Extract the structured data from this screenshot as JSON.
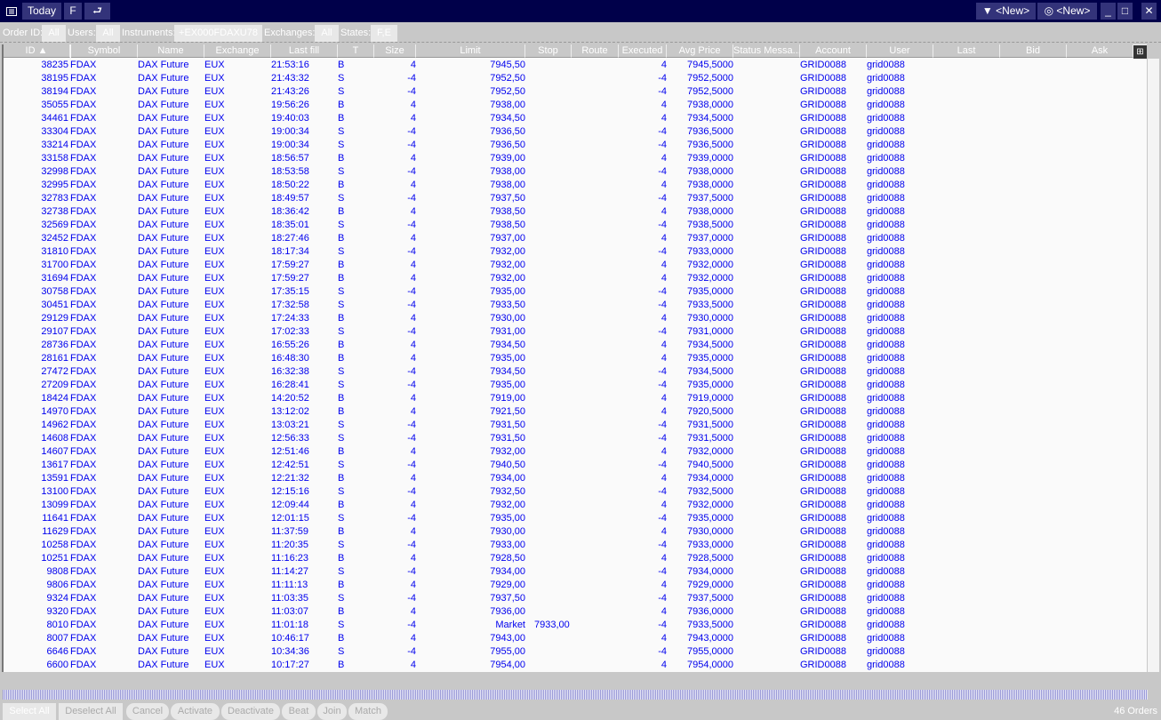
{
  "toolbar": {
    "today": "Today",
    "f": "F",
    "filter_new": "<New>",
    "view_new": "<New>"
  },
  "filters": {
    "order_id_label": "Order ID:",
    "order_id": "All",
    "users_label": "Users:",
    "users": "All",
    "instruments_label": "Instruments:",
    "instruments": "+EX000FDAXU78",
    "exchanges_label": "Exchanges:",
    "exchanges": "All",
    "states_label": "States:",
    "states": "F,E"
  },
  "columns": [
    "ID ▲",
    "Symbol",
    "Name",
    "Exchange",
    "Last fill",
    "T",
    "Size",
    "Limit",
    "Stop",
    "Route",
    "Executed",
    "Avg Price",
    "Status Messa...",
    "Account",
    "User",
    "Last",
    "Bid",
    "Ask"
  ],
  "table": {
    "rows": [
      [
        "38235",
        "FDAX",
        "DAX Future",
        "EUX",
        "21:53:16",
        "B",
        "4",
        "7945,50",
        "",
        "",
        "4",
        "7945,5000",
        "",
        "GRID0088",
        "grid0088"
      ],
      [
        "38195",
        "FDAX",
        "DAX Future",
        "EUX",
        "21:43:32",
        "S",
        "-4",
        "7952,50",
        "",
        "",
        "-4",
        "7952,5000",
        "",
        "GRID0088",
        "grid0088"
      ],
      [
        "38194",
        "FDAX",
        "DAX Future",
        "EUX",
        "21:43:26",
        "S",
        "-4",
        "7952,50",
        "",
        "",
        "-4",
        "7952,5000",
        "",
        "GRID0088",
        "grid0088"
      ],
      [
        "35055",
        "FDAX",
        "DAX Future",
        "EUX",
        "19:56:26",
        "B",
        "4",
        "7938,00",
        "",
        "",
        "4",
        "7938,0000",
        "",
        "GRID0088",
        "grid0088"
      ],
      [
        "34461",
        "FDAX",
        "DAX Future",
        "EUX",
        "19:40:03",
        "B",
        "4",
        "7934,50",
        "",
        "",
        "4",
        "7934,5000",
        "",
        "GRID0088",
        "grid0088"
      ],
      [
        "33304",
        "FDAX",
        "DAX Future",
        "EUX",
        "19:00:34",
        "S",
        "-4",
        "7936,50",
        "",
        "",
        "-4",
        "7936,5000",
        "",
        "GRID0088",
        "grid0088"
      ],
      [
        "33214",
        "FDAX",
        "DAX Future",
        "EUX",
        "19:00:34",
        "S",
        "-4",
        "7936,50",
        "",
        "",
        "-4",
        "7936,5000",
        "",
        "GRID0088",
        "grid0088"
      ],
      [
        "33158",
        "FDAX",
        "DAX Future",
        "EUX",
        "18:56:57",
        "B",
        "4",
        "7939,00",
        "",
        "",
        "4",
        "7939,0000",
        "",
        "GRID0088",
        "grid0088"
      ],
      [
        "32998",
        "FDAX",
        "DAX Future",
        "EUX",
        "18:53:58",
        "S",
        "-4",
        "7938,00",
        "",
        "",
        "-4",
        "7938,0000",
        "",
        "GRID0088",
        "grid0088"
      ],
      [
        "32995",
        "FDAX",
        "DAX Future",
        "EUX",
        "18:50:22",
        "B",
        "4",
        "7938,00",
        "",
        "",
        "4",
        "7938,0000",
        "",
        "GRID0088",
        "grid0088"
      ],
      [
        "32783",
        "FDAX",
        "DAX Future",
        "EUX",
        "18:49:57",
        "S",
        "-4",
        "7937,50",
        "",
        "",
        "-4",
        "7937,5000",
        "",
        "GRID0088",
        "grid0088"
      ],
      [
        "32738",
        "FDAX",
        "DAX Future",
        "EUX",
        "18:36:42",
        "B",
        "4",
        "7938,50",
        "",
        "",
        "4",
        "7938,0000",
        "",
        "GRID0088",
        "grid0088"
      ],
      [
        "32569",
        "FDAX",
        "DAX Future",
        "EUX",
        "18:35:01",
        "S",
        "-4",
        "7938,50",
        "",
        "",
        "-4",
        "7938,5000",
        "",
        "GRID0088",
        "grid0088"
      ],
      [
        "32452",
        "FDAX",
        "DAX Future",
        "EUX",
        "18:27:46",
        "B",
        "4",
        "7937,00",
        "",
        "",
        "4",
        "7937,0000",
        "",
        "GRID0088",
        "grid0088"
      ],
      [
        "31810",
        "FDAX",
        "DAX Future",
        "EUX",
        "18:17:34",
        "S",
        "-4",
        "7932,00",
        "",
        "",
        "-4",
        "7933,0000",
        "",
        "GRID0088",
        "grid0088"
      ],
      [
        "31700",
        "FDAX",
        "DAX Future",
        "EUX",
        "17:59:27",
        "B",
        "4",
        "7932,00",
        "",
        "",
        "4",
        "7932,0000",
        "",
        "GRID0088",
        "grid0088"
      ],
      [
        "31694",
        "FDAX",
        "DAX Future",
        "EUX",
        "17:59:27",
        "B",
        "4",
        "7932,00",
        "",
        "",
        "4",
        "7932,0000",
        "",
        "GRID0088",
        "grid0088"
      ],
      [
        "30758",
        "FDAX",
        "DAX Future",
        "EUX",
        "17:35:15",
        "S",
        "-4",
        "7935,00",
        "",
        "",
        "-4",
        "7935,0000",
        "",
        "GRID0088",
        "grid0088"
      ],
      [
        "30451",
        "FDAX",
        "DAX Future",
        "EUX",
        "17:32:58",
        "S",
        "-4",
        "7933,50",
        "",
        "",
        "-4",
        "7933,5000",
        "",
        "GRID0088",
        "grid0088"
      ],
      [
        "29129",
        "FDAX",
        "DAX Future",
        "EUX",
        "17:24:33",
        "B",
        "4",
        "7930,00",
        "",
        "",
        "4",
        "7930,0000",
        "",
        "GRID0088",
        "grid0088"
      ],
      [
        "29107",
        "FDAX",
        "DAX Future",
        "EUX",
        "17:02:33",
        "S",
        "-4",
        "7931,00",
        "",
        "",
        "-4",
        "7931,0000",
        "",
        "GRID0088",
        "grid0088"
      ],
      [
        "28736",
        "FDAX",
        "DAX Future",
        "EUX",
        "16:55:26",
        "B",
        "4",
        "7934,50",
        "",
        "",
        "4",
        "7934,5000",
        "",
        "GRID0088",
        "grid0088"
      ],
      [
        "28161",
        "FDAX",
        "DAX Future",
        "EUX",
        "16:48:30",
        "B",
        "4",
        "7935,00",
        "",
        "",
        "4",
        "7935,0000",
        "",
        "GRID0088",
        "grid0088"
      ],
      [
        "27472",
        "FDAX",
        "DAX Future",
        "EUX",
        "16:32:38",
        "S",
        "-4",
        "7934,50",
        "",
        "",
        "-4",
        "7934,5000",
        "",
        "GRID0088",
        "grid0088"
      ],
      [
        "27209",
        "FDAX",
        "DAX Future",
        "EUX",
        "16:28:41",
        "S",
        "-4",
        "7935,00",
        "",
        "",
        "-4",
        "7935,0000",
        "",
        "GRID0088",
        "grid0088"
      ],
      [
        "18424",
        "FDAX",
        "DAX Future",
        "EUX",
        "14:20:52",
        "B",
        "4",
        "7919,00",
        "",
        "",
        "4",
        "7919,0000",
        "",
        "GRID0088",
        "grid0088"
      ],
      [
        "14970",
        "FDAX",
        "DAX Future",
        "EUX",
        "13:12:02",
        "B",
        "4",
        "7921,50",
        "",
        "",
        "4",
        "7920,5000",
        "",
        "GRID0088",
        "grid0088"
      ],
      [
        "14962",
        "FDAX",
        "DAX Future",
        "EUX",
        "13:03:21",
        "S",
        "-4",
        "7931,50",
        "",
        "",
        "-4",
        "7931,5000",
        "",
        "GRID0088",
        "grid0088"
      ],
      [
        "14608",
        "FDAX",
        "DAX Future",
        "EUX",
        "12:56:33",
        "S",
        "-4",
        "7931,50",
        "",
        "",
        "-4",
        "7931,5000",
        "",
        "GRID0088",
        "grid0088"
      ],
      [
        "14607",
        "FDAX",
        "DAX Future",
        "EUX",
        "12:51:46",
        "B",
        "4",
        "7932,00",
        "",
        "",
        "4",
        "7932,0000",
        "",
        "GRID0088",
        "grid0088"
      ],
      [
        "13617",
        "FDAX",
        "DAX Future",
        "EUX",
        "12:42:51",
        "S",
        "-4",
        "7940,50",
        "",
        "",
        "-4",
        "7940,5000",
        "",
        "GRID0088",
        "grid0088"
      ],
      [
        "13591",
        "FDAX",
        "DAX Future",
        "EUX",
        "12:21:32",
        "B",
        "4",
        "7934,00",
        "",
        "",
        "4",
        "7934,0000",
        "",
        "GRID0088",
        "grid0088"
      ],
      [
        "13100",
        "FDAX",
        "DAX Future",
        "EUX",
        "12:15:16",
        "S",
        "-4",
        "7932,50",
        "",
        "",
        "-4",
        "7932,5000",
        "",
        "GRID0088",
        "grid0088"
      ],
      [
        "13099",
        "FDAX",
        "DAX Future",
        "EUX",
        "12:09:44",
        "B",
        "4",
        "7932,00",
        "",
        "",
        "4",
        "7932,0000",
        "",
        "GRID0088",
        "grid0088"
      ],
      [
        "11641",
        "FDAX",
        "DAX Future",
        "EUX",
        "12:01:15",
        "S",
        "-4",
        "7935,00",
        "",
        "",
        "-4",
        "7935,0000",
        "",
        "GRID0088",
        "grid0088"
      ],
      [
        "11629",
        "FDAX",
        "DAX Future",
        "EUX",
        "11:37:59",
        "B",
        "4",
        "7930,00",
        "",
        "",
        "4",
        "7930,0000",
        "",
        "GRID0088",
        "grid0088"
      ],
      [
        "10258",
        "FDAX",
        "DAX Future",
        "EUX",
        "11:20:35",
        "S",
        "-4",
        "7933,00",
        "",
        "",
        "-4",
        "7933,0000",
        "",
        "GRID0088",
        "grid0088"
      ],
      [
        "10251",
        "FDAX",
        "DAX Future",
        "EUX",
        "11:16:23",
        "B",
        "4",
        "7928,50",
        "",
        "",
        "4",
        "7928,5000",
        "",
        "GRID0088",
        "grid0088"
      ],
      [
        "9808",
        "FDAX",
        "DAX Future",
        "EUX",
        "11:14:27",
        "S",
        "-4",
        "7934,00",
        "",
        "",
        "-4",
        "7934,0000",
        "",
        "GRID0088",
        "grid0088"
      ],
      [
        "9806",
        "FDAX",
        "DAX Future",
        "EUX",
        "11:11:13",
        "B",
        "4",
        "7929,00",
        "",
        "",
        "4",
        "7929,0000",
        "",
        "GRID0088",
        "grid0088"
      ],
      [
        "9324",
        "FDAX",
        "DAX Future",
        "EUX",
        "11:03:35",
        "S",
        "-4",
        "7937,50",
        "",
        "",
        "-4",
        "7937,5000",
        "",
        "GRID0088",
        "grid0088"
      ],
      [
        "9320",
        "FDAX",
        "DAX Future",
        "EUX",
        "11:03:07",
        "B",
        "4",
        "7936,00",
        "",
        "",
        "4",
        "7936,0000",
        "",
        "GRID0088",
        "grid0088"
      ],
      [
        "8010",
        "FDAX",
        "DAX Future",
        "EUX",
        "11:01:18",
        "S",
        "-4",
        "Market",
        "7933,00",
        "",
        "-4",
        "7933,5000",
        "",
        "GRID0088",
        "grid0088"
      ],
      [
        "8007",
        "FDAX",
        "DAX Future",
        "EUX",
        "10:46:17",
        "B",
        "4",
        "7943,00",
        "",
        "",
        "4",
        "7943,0000",
        "",
        "GRID0088",
        "grid0088"
      ],
      [
        "6646",
        "FDAX",
        "DAX Future",
        "EUX",
        "10:34:36",
        "S",
        "-4",
        "7955,00",
        "",
        "",
        "-4",
        "7955,0000",
        "",
        "GRID0088",
        "grid0088"
      ],
      [
        "6600",
        "FDAX",
        "DAX Future",
        "EUX",
        "10:17:27",
        "B",
        "4",
        "7954,00",
        "",
        "",
        "4",
        "7954,0000",
        "",
        "GRID0088",
        "grid0088"
      ]
    ]
  },
  "actions": {
    "select_all": "Select All",
    "deselect_all": "Deselect All",
    "cancel": "Cancel",
    "activate": "Activate",
    "deactivate": "Deactivate",
    "beat": "Beat",
    "join": "Join",
    "match": "Match"
  },
  "status": {
    "count": "46 Orders"
  }
}
